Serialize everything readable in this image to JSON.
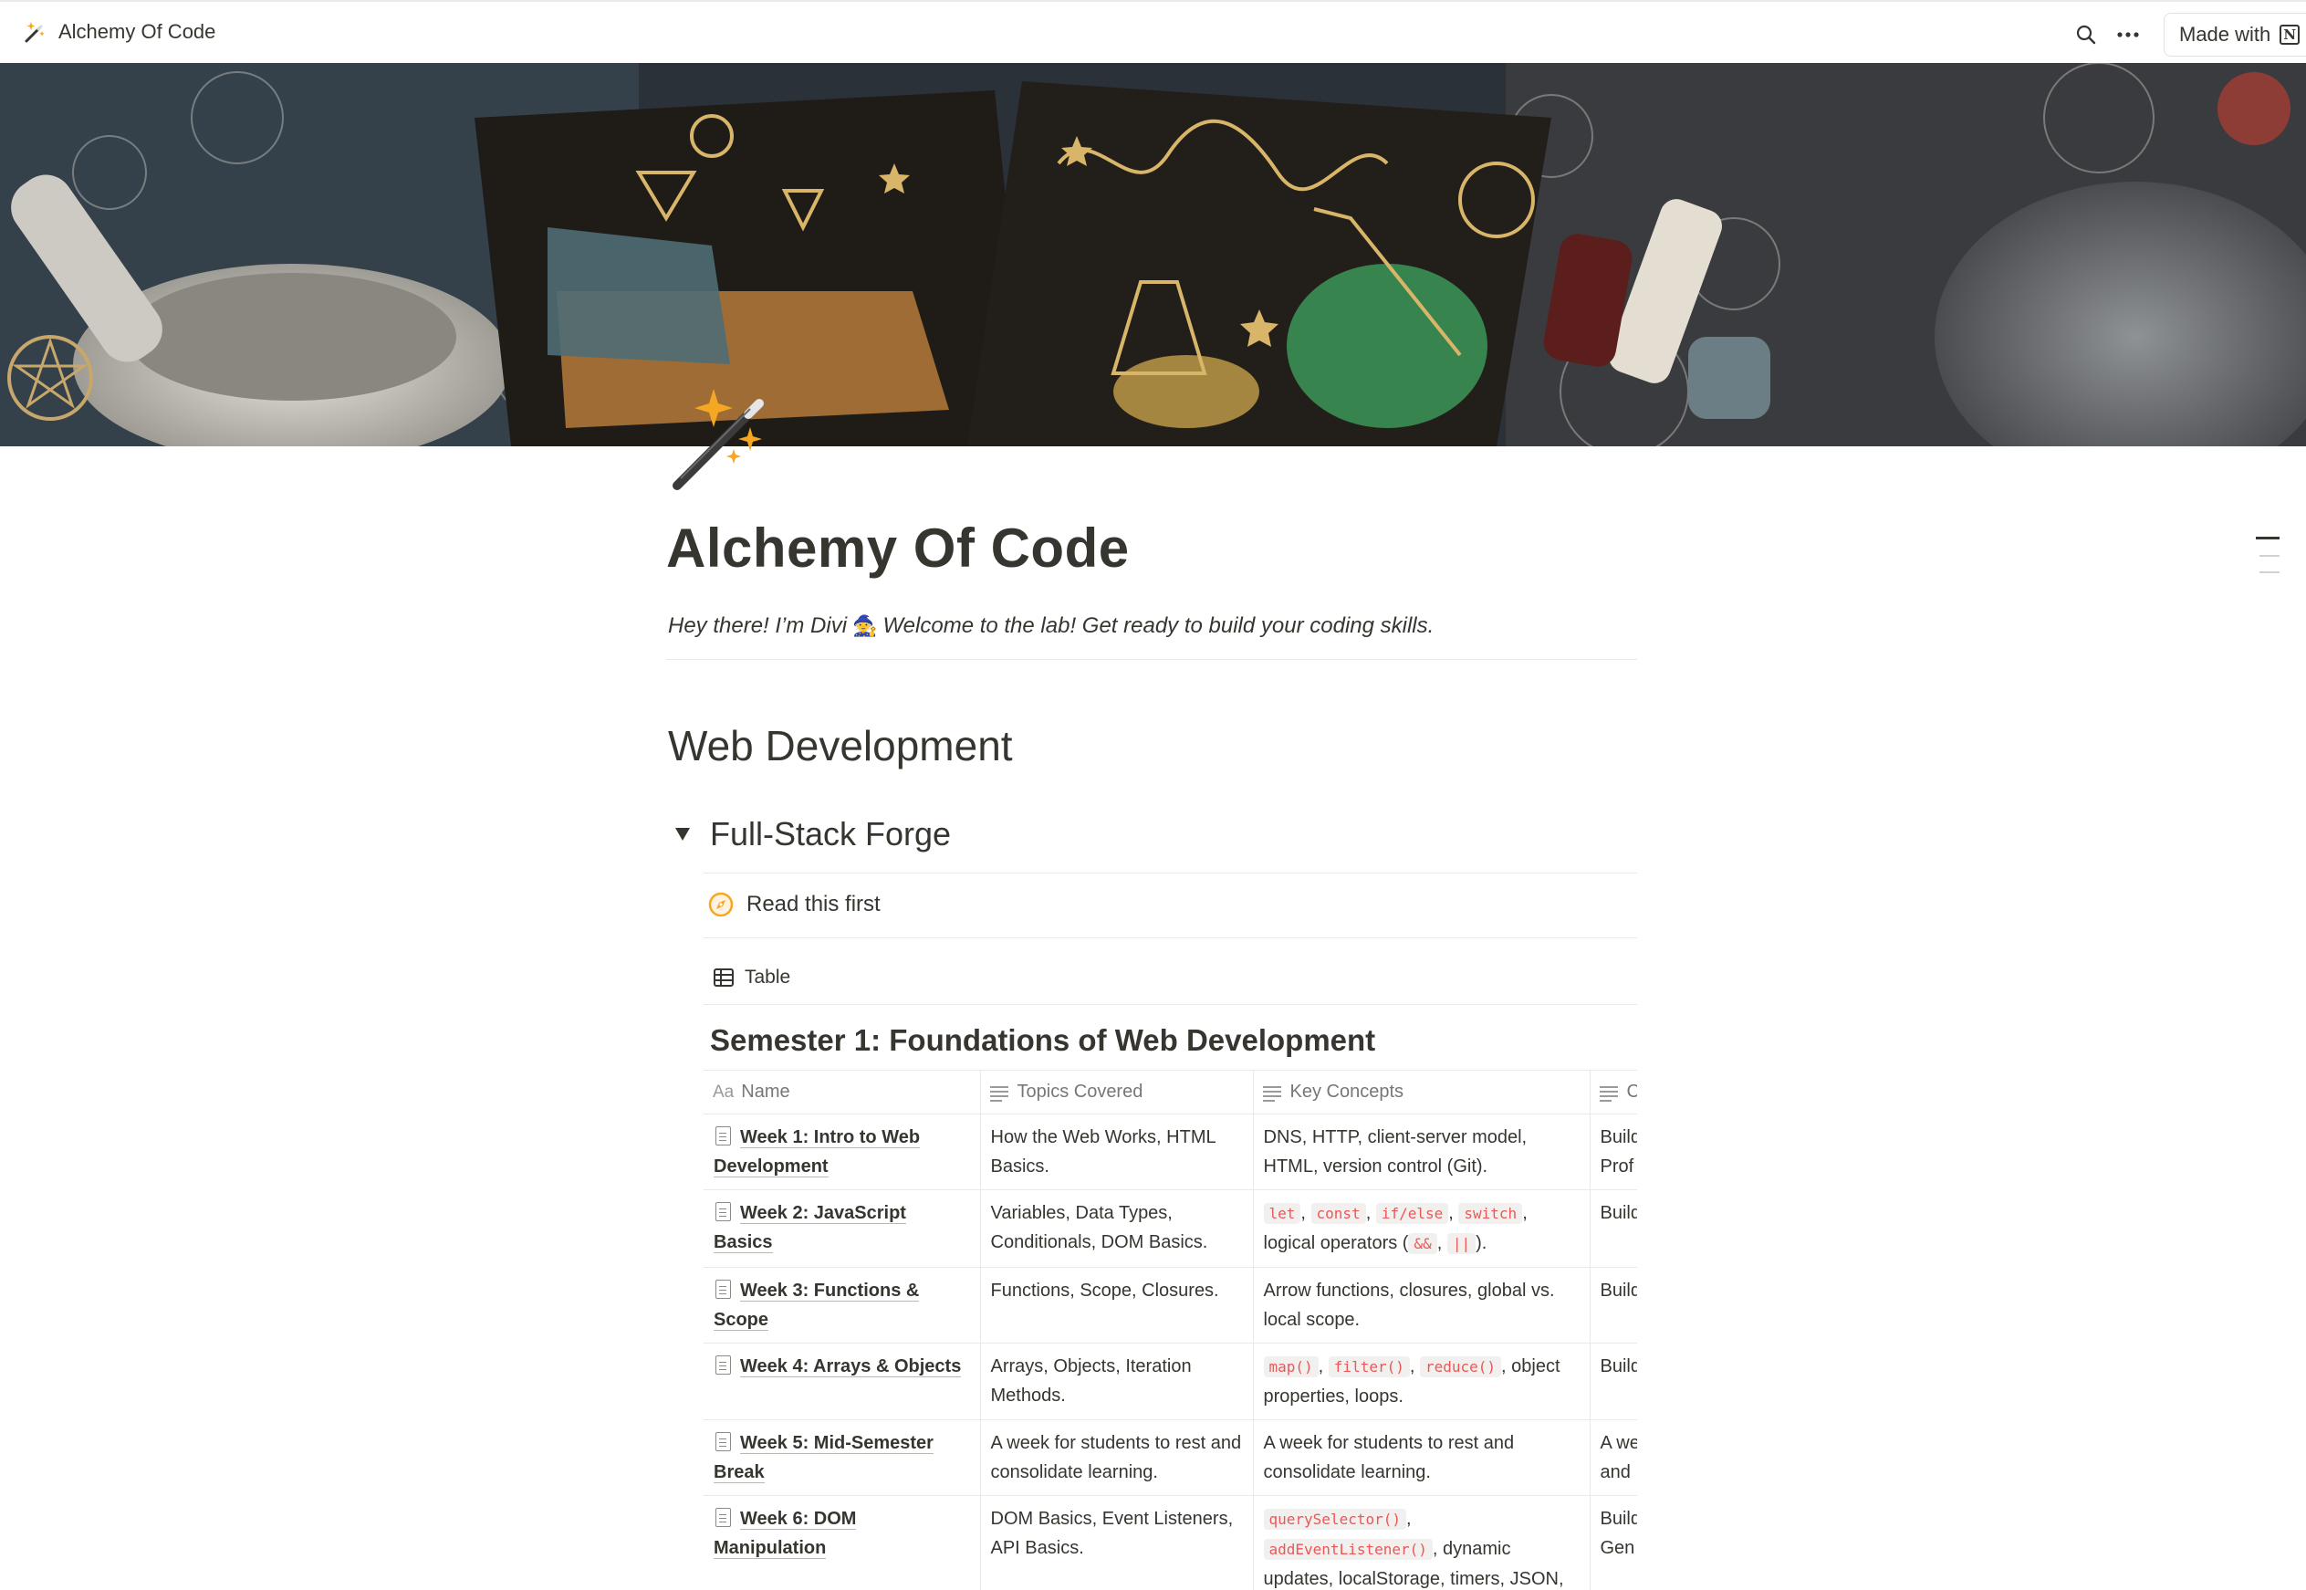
{
  "topbar": {
    "breadcrumb": "Alchemy Of Code",
    "made_with_label": "Made with",
    "notion_logo_letter": "N"
  },
  "page": {
    "title": "Alchemy Of Code",
    "intro_before": "Hey there! I’m Divi",
    "intro_emoji": "🧙",
    "intro_after": "Welcome to the lab! Get ready to build your coding skills."
  },
  "section": {
    "heading": "Web Development",
    "toggle_label": "Full-Stack Forge",
    "callout_label": "Read this first",
    "view_tab_label": "Table",
    "database_title": "Semester 1: Foundations of Web Development"
  },
  "table": {
    "headers": {
      "name_prefix": "Aa",
      "name": "Name",
      "topics": "Topics Covered",
      "concepts": "Key Concepts",
      "fourth": "C"
    },
    "rows": [
      {
        "name": "Week 1: Intro to Web Development",
        "topics": "How the Web Works, HTML Basics.",
        "concepts_text": "DNS, HTTP, client-server model, HTML, version control (Git).",
        "fourth": "Build\nProf"
      },
      {
        "name": "Week 2: JavaScript Basics",
        "topics": "Variables, Data Types, Conditionals, DOM Basics.",
        "concepts_code": [
          "let",
          "const",
          "if/else",
          "switch"
        ],
        "concepts_text2": "logical operators (",
        "concepts_code2": [
          "&&",
          "||"
        ],
        "concepts_tail": ").",
        "fourth": "Build"
      },
      {
        "name": "Week 3: Functions & Scope",
        "topics": "Functions, Scope, Closures.",
        "concepts_text": "Arrow functions, closures, global vs. local scope.",
        "fourth": "Build"
      },
      {
        "name": "Week 4: Arrays & Objects",
        "topics": "Arrays, Objects, Iteration Methods.",
        "concepts_code": [
          "map()",
          "filter()",
          "reduce()"
        ],
        "concepts_text2": ", object properties, loops.",
        "fourth": "Build"
      },
      {
        "name": "Week 5: Mid-Semester Break",
        "topics": "A week for students to rest and consolidate learning.",
        "concepts_text": "A week for students to rest and consolidate learning.",
        "fourth": "A we\nand"
      },
      {
        "name": "Week 6: DOM Manipulation",
        "topics": "DOM Basics, Event Listeners, API Basics.",
        "concepts_code": [
          "querySelector()",
          "addEventListener()"
        ],
        "concepts_text2": ", dynamic updates, localStorage, timers, JSON, error handling, fetch",
        "fourth": "Build\nGen"
      }
    ]
  },
  "colors": {
    "text": "#37352f",
    "muted": "#787774",
    "code_red": "#eb5757",
    "code_bg": "#f1f0ee",
    "divider": "#e9e9e7",
    "accent_gold": "#f5a623"
  },
  "icons": [
    "magic-wand-icon",
    "search-icon",
    "more-icon",
    "notion-logo-icon",
    "triangle-down-icon",
    "compass-icon",
    "table-icon",
    "page-icon",
    "text-lines-icon"
  ]
}
